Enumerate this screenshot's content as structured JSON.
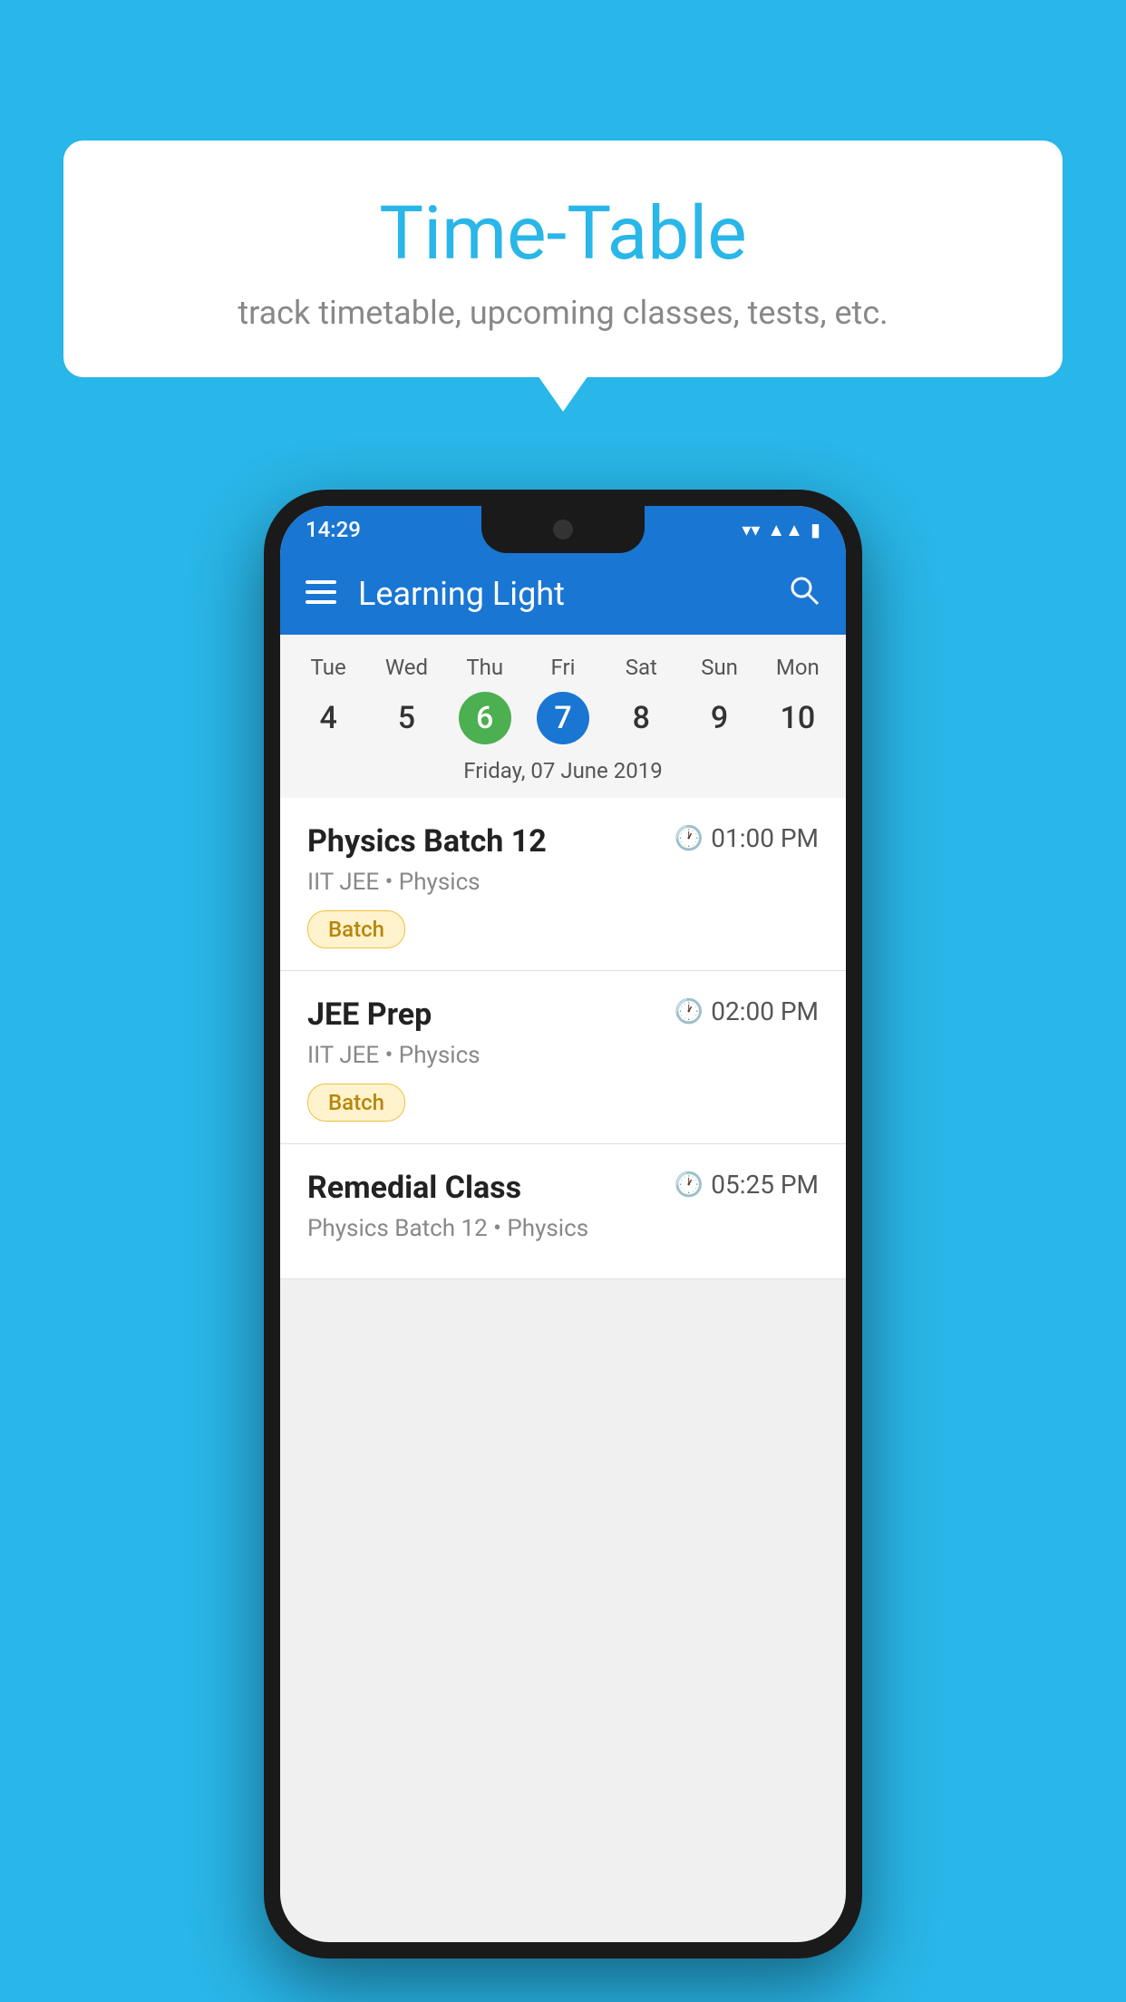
{
  "background_color": "#29b6e8",
  "bubble": {
    "title": "Time-Table",
    "subtitle": "track timetable, upcoming classes, tests, etc."
  },
  "phone": {
    "status_bar": {
      "time": "14:29",
      "icons": [
        "wifi",
        "signal",
        "battery"
      ]
    },
    "app_bar": {
      "title": "Learning Light",
      "hamburger_label": "≡",
      "search_label": "🔍"
    },
    "calendar": {
      "days": [
        "Tue",
        "Wed",
        "Thu",
        "Fri",
        "Sat",
        "Sun",
        "Mon"
      ],
      "dates": [
        "4",
        "5",
        "6",
        "7",
        "8",
        "9",
        "10"
      ],
      "today_index": 2,
      "selected_index": 3,
      "selected_date_label": "Friday, 07 June 2019"
    },
    "classes": [
      {
        "name": "Physics Batch 12",
        "time": "01:00 PM",
        "info": "IIT JEE • Physics",
        "badge": "Batch"
      },
      {
        "name": "JEE Prep",
        "time": "02:00 PM",
        "info": "IIT JEE • Physics",
        "badge": "Batch"
      },
      {
        "name": "Remedial Class",
        "time": "05:25 PM",
        "info": "Physics Batch 12 • Physics",
        "badge": null
      }
    ]
  }
}
